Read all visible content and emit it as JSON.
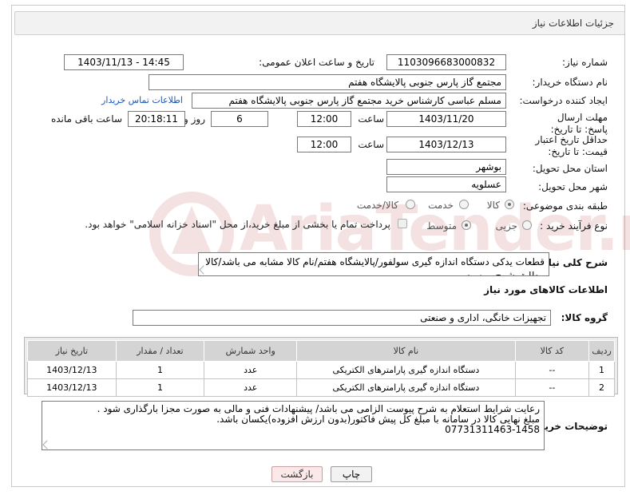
{
  "header": {
    "title": "جزئیات اطلاعات نیاز"
  },
  "form": {
    "need_number_label": "شماره نیاز:",
    "need_number": "1103096683000832",
    "announce_label": "تاریخ و ساعت اعلان عمومی:",
    "announce_value": "1403/11/13 - 14:45",
    "buyer_org_label": "نام دستگاه خریدار:",
    "buyer_org": "مجتمع گاز پارس جنوبی  پالایشگاه هفتم",
    "requester_label": "ایجاد کننده درخواست:",
    "requester": "مسلم عباسی کارشناس خرید مجتمع گاز پارس جنوبی  پالایشگاه هفتم",
    "buyer_contact_link": "اطلاعات تماس خریدار",
    "deadline_label": "مهلت ارسال پاسخ: تا تاریخ:",
    "deadline_date": "1403/11/20",
    "time_word": "ساعت",
    "deadline_time": "12:00",
    "days_value": "6",
    "days_and_label": "روز و",
    "remaining_time": "20:18:11",
    "remaining_label": "ساعت باقی مانده",
    "validity_label": "حداقل تاریخ اعتبار قیمت: تا تاریخ:",
    "validity_date": "1403/12/13",
    "validity_time": "12:00",
    "province_label": "استان محل تحویل:",
    "province": "بوشهر",
    "city_label": "شهر محل تحویل:",
    "city": "عسلویه",
    "category_label": "طبقه بندی موضوعی:",
    "category_options": [
      "کالا",
      "خدمت",
      "کالا/خدمت"
    ],
    "category_selected": "کالا",
    "process_label": "نوع فرآیند خرید :",
    "process_options": [
      "جزیی",
      "متوسط"
    ],
    "process_selected": "متوسط",
    "payment_note": "پرداخت تمام یا بخشی از مبلغ خرید،از محل \"اسناد خزانه اسلامی\" خواهد بود."
  },
  "description": {
    "label": "شرح کلی نیاز:",
    "value": "قطعات یدکی دستگاه اندازه گیری سولفور/پالایشگاه هفتم/نام کالا مشابه می باشد/کالا مطابق شرح پیوست"
  },
  "goods_section": {
    "title": "اطلاعات کالاهای مورد نیاز",
    "group_label": "گروه کالا:",
    "group_value": "تجهیزات خانگی، اداری و صنعتی"
  },
  "table": {
    "headers": [
      "ردیف",
      "کد کالا",
      "نام کالا",
      "واحد شمارش",
      "تعداد / مقدار",
      "تاریخ نیاز"
    ],
    "rows": [
      [
        "1",
        "--",
        "دستگاه اندازه گیری پارامترهای الکتریکی",
        "عدد",
        "1",
        "1403/12/13"
      ],
      [
        "2",
        "--",
        "دستگاه اندازه گیری پارامترهای الکتریکی",
        "عدد",
        "1",
        "1403/12/13"
      ]
    ]
  },
  "buyer_notes": {
    "label": "توضیحات خریدار:",
    "lines": [
      "رعایت شرایط استعلام به شرح پیوست الزامی می باشد/ پیشنهادات فنی و مالی به صورت مجزا بارگذاری شود .",
      "مبلغ نهایی کالا در سامانه با مبلغ کل پیش فاکتور(بدون ارزش افزوده)یکسان باشد.",
      "07731311463-1458"
    ]
  },
  "buttons": {
    "print": "چاپ",
    "back": "بازگشت"
  },
  "watermark": {
    "text": "AriaTender.net"
  },
  "colors": {
    "link": "#1a56b6",
    "header_bg": "#f2f2f2",
    "table_header_bg": "#d4d4d4",
    "watermark": "#b31f24"
  }
}
